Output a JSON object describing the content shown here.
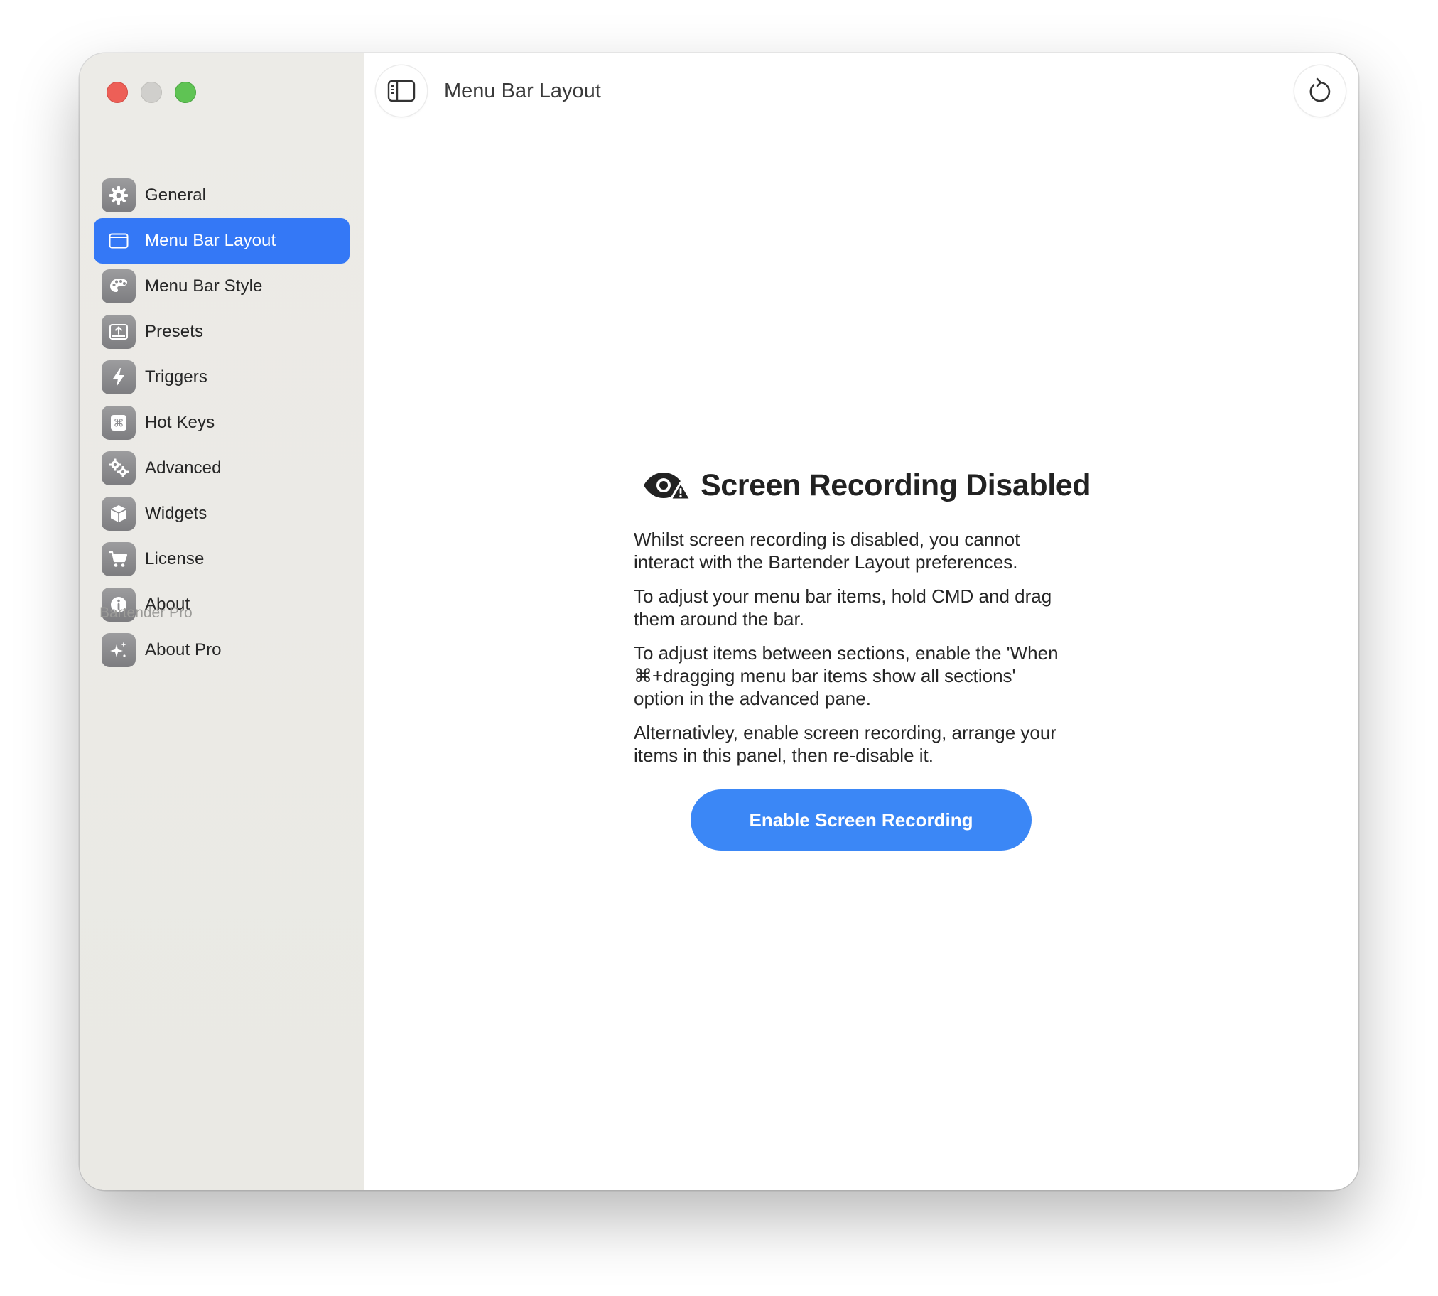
{
  "window": {
    "title": "Menu Bar Layout"
  },
  "sidebar": {
    "items": [
      {
        "label": "General",
        "icon": "gear-icon"
      },
      {
        "label": "Menu Bar Layout",
        "icon": "window-icon",
        "active": true
      },
      {
        "label": "Menu Bar Style",
        "icon": "palette-icon"
      },
      {
        "label": "Presets",
        "icon": "upload-tray-icon"
      },
      {
        "label": "Triggers",
        "icon": "bolt-icon"
      },
      {
        "label": "Hot Keys",
        "icon": "command-key-icon"
      },
      {
        "label": "Advanced",
        "icon": "gears-icon"
      },
      {
        "label": "Widgets",
        "icon": "cube-icon"
      },
      {
        "label": "License",
        "icon": "cart-icon"
      },
      {
        "label": "About",
        "icon": "info-icon"
      }
    ],
    "section_title": "Bartender Pro",
    "pro_items": [
      {
        "label": "About Pro",
        "icon": "sparkles-icon"
      }
    ]
  },
  "main": {
    "heading": "Screen Recording Disabled",
    "heading_icon": "eye-warning-icon",
    "paragraphs": [
      [
        "Whilst screen recording is disabled, you cannot",
        "interact with the Bartender Layout preferences."
      ],
      [
        "To adjust your menu bar items, hold CMD and drag",
        "them around the bar."
      ],
      [
        "To adjust items between sections, enable the 'When",
        "⌘+dragging menu bar items show all sections'",
        "option in the advanced pane."
      ],
      [
        "Alternativley, enable screen recording, arrange your",
        "items in this panel, then re-disable it."
      ]
    ],
    "button_label": "Enable Screen Recording"
  },
  "colors": {
    "accent": "#3478f6",
    "button": "#3b87f6",
    "sidebar_bg": "#ecebe7"
  }
}
